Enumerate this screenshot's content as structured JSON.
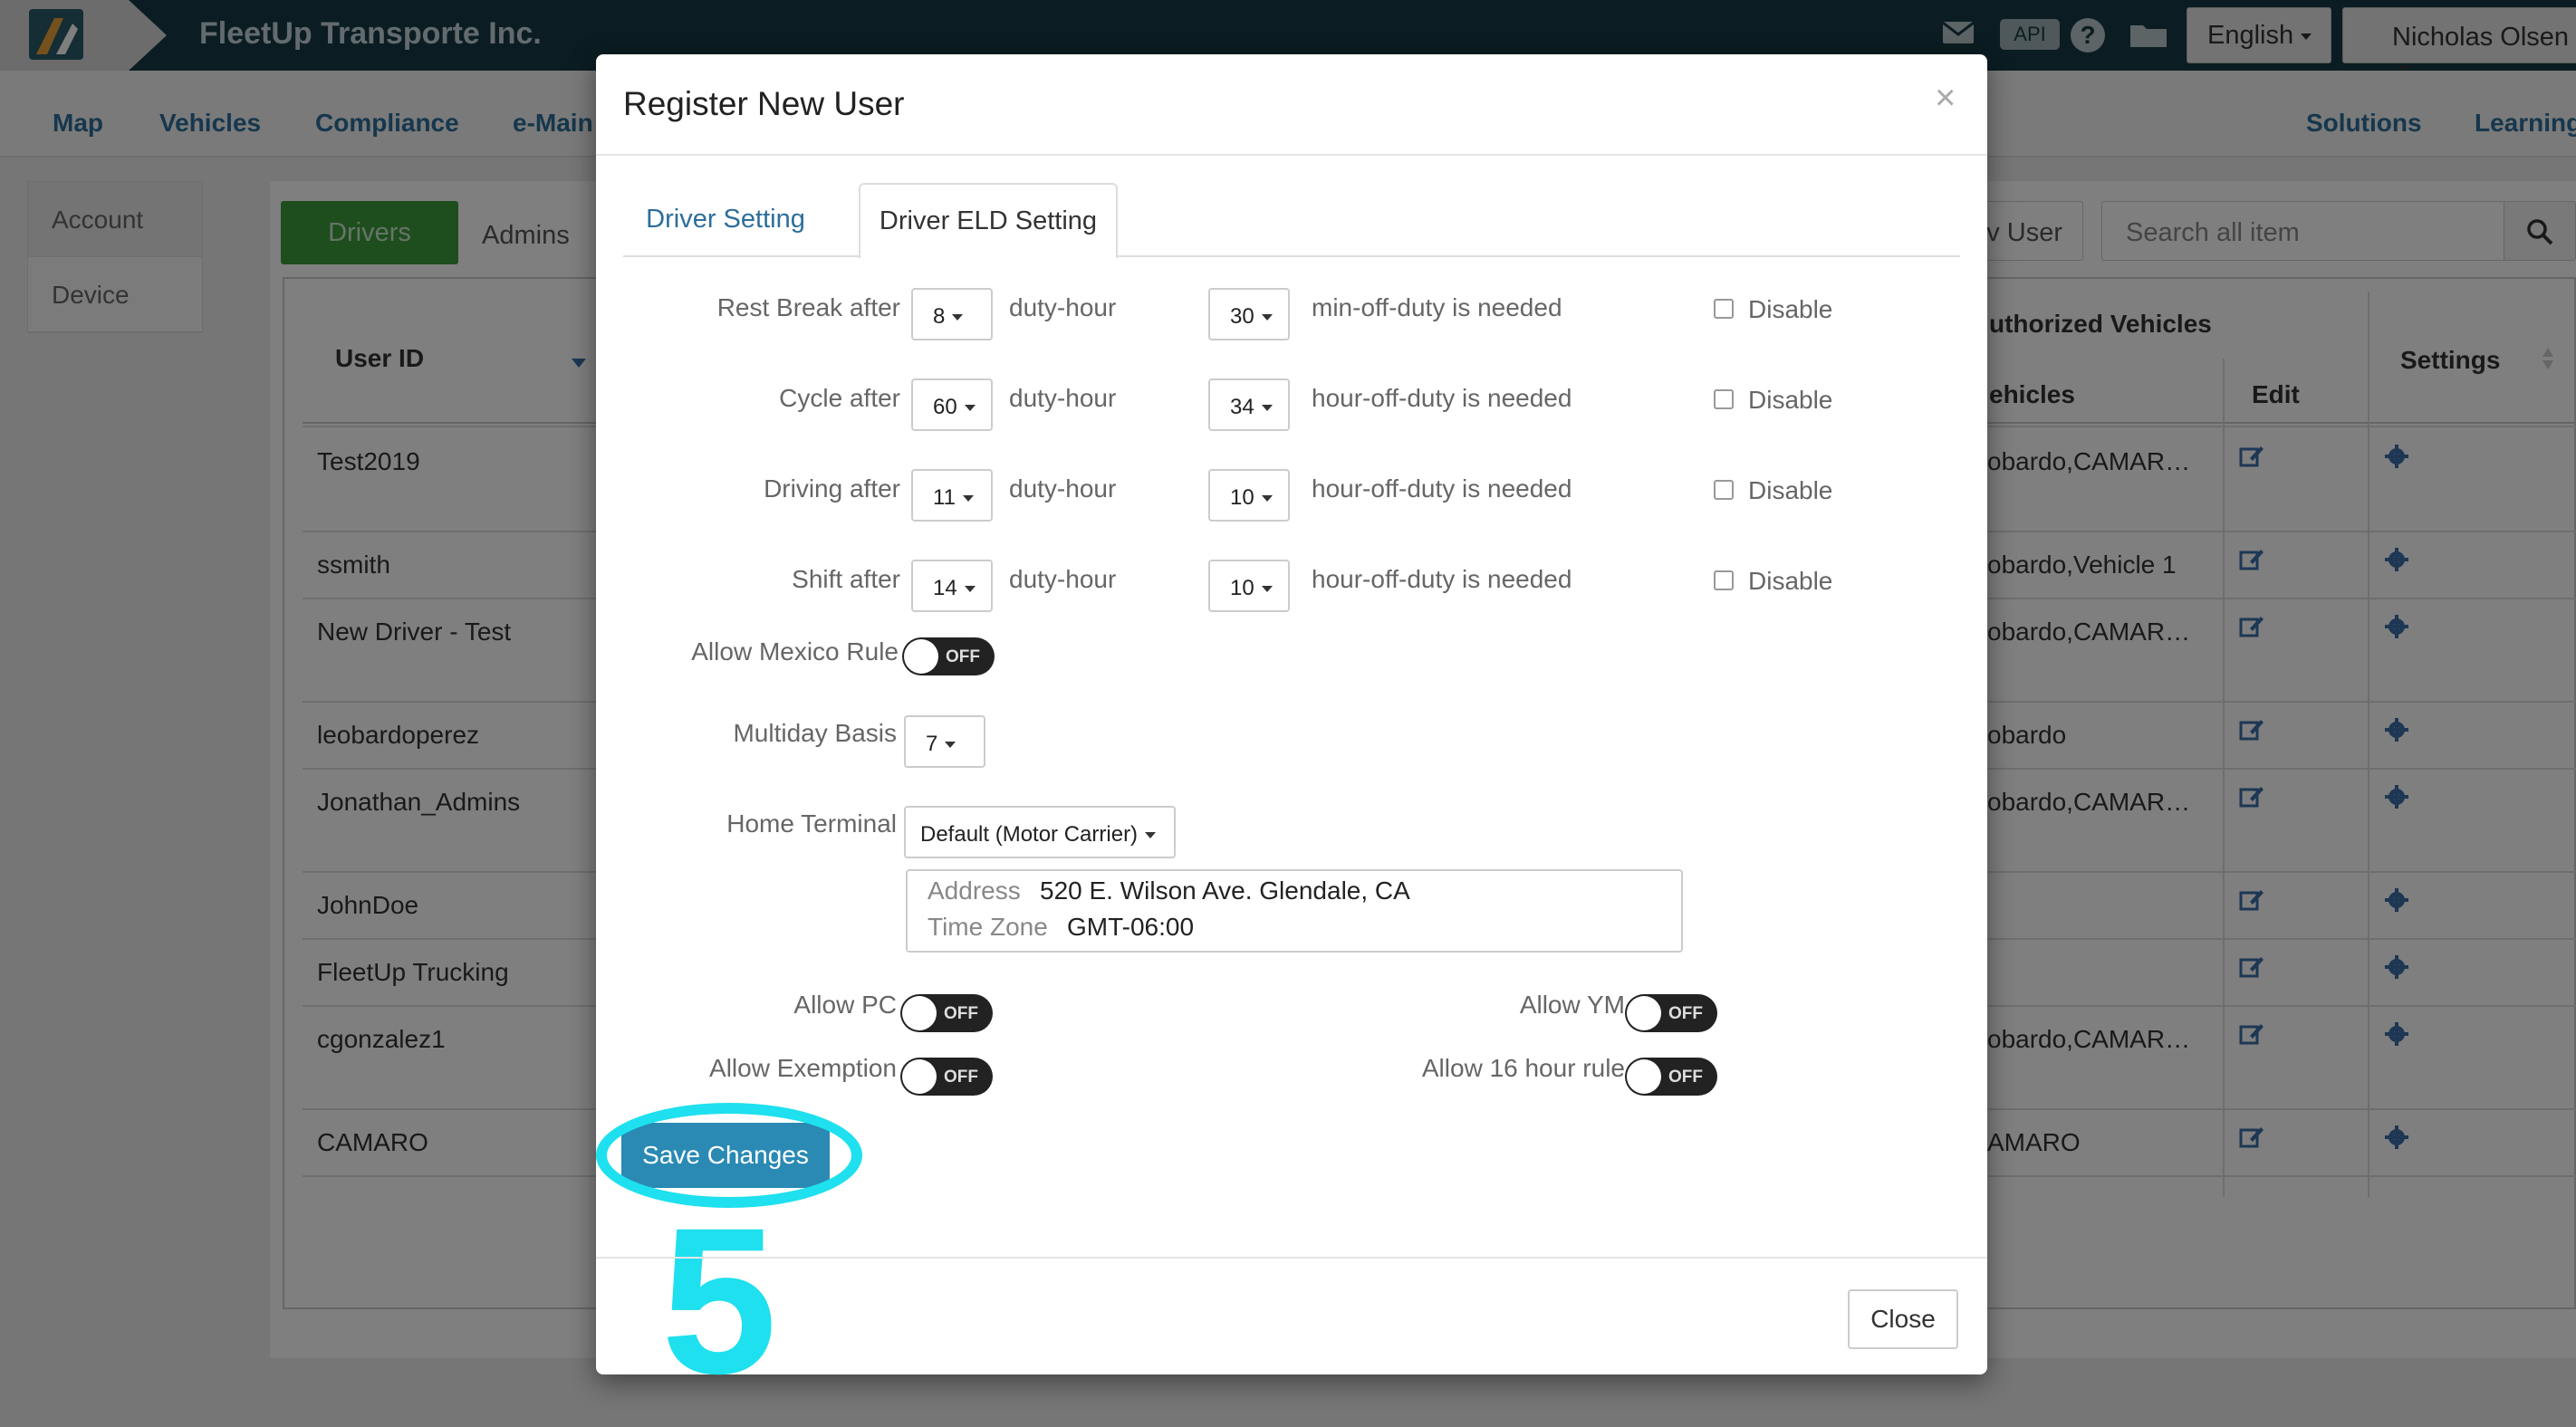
{
  "app": {
    "company": "FleetUp Transporte Inc.",
    "api_label": "API",
    "help_label": "?",
    "language": "English",
    "user": "Nicholas Olsen"
  },
  "nav": {
    "items": [
      "Map",
      "Vehicles",
      "Compliance",
      "e-Main"
    ],
    "right_items": [
      "Solutions",
      "Learning"
    ]
  },
  "side_menu": [
    "Account",
    "Device"
  ],
  "page": {
    "tab_drivers": "Drivers",
    "tab_admins": "Admins",
    "add_user_fragment": "v User",
    "search_placeholder": "Search all item"
  },
  "table": {
    "col_user_id": "User ID",
    "col_authorized_vehicles": "uthorized Vehicles",
    "col_vehicles": "ehicles",
    "col_edit": "Edit",
    "col_settings": "Settings",
    "rows": [
      {
        "user_id": "Test2019",
        "vehicles": "obardo,CAMAR…"
      },
      {
        "user_id": "ssmith",
        "vehicles": "obardo,Vehicle 1"
      },
      {
        "user_id": "New Driver - Test",
        "vehicles": "obardo,CAMAR…"
      },
      {
        "user_id": "leobardoperez",
        "vehicles": "obardo"
      },
      {
        "user_id": "Jonathan_Admins",
        "vehicles": "obardo,CAMAR…"
      },
      {
        "user_id": "JohnDoe",
        "vehicles": ""
      },
      {
        "user_id": "FleetUp Trucking",
        "vehicles": ""
      },
      {
        "user_id": "cgonzalez1",
        "vehicles": "obardo,CAMAR…"
      },
      {
        "user_id": "CAMARO",
        "vehicles": "AMARO"
      }
    ]
  },
  "modal": {
    "title": "Register New User",
    "close_x": "×",
    "tab_driver_setting": "Driver Setting",
    "tab_driver_eld_setting": "Driver ELD Setting",
    "rules": [
      {
        "label": "Rest Break after",
        "hours": "8",
        "unit": "duty-hour",
        "off_value": "30",
        "off_text": "min-off-duty is needed",
        "disable": "Disable"
      },
      {
        "label": "Cycle after",
        "hours": "60",
        "unit": "duty-hour",
        "off_value": "34",
        "off_text": "hour-off-duty is needed",
        "disable": "Disable"
      },
      {
        "label": "Driving after",
        "hours": "11",
        "unit": "duty-hour",
        "off_value": "10",
        "off_text": "hour-off-duty is needed",
        "disable": "Disable"
      },
      {
        "label": "Shift after",
        "hours": "14",
        "unit": "duty-hour",
        "off_value": "10",
        "off_text": "hour-off-duty is needed",
        "disable": "Disable"
      }
    ],
    "mexico_rule_label": "Allow Mexico Rule",
    "toggle_off": "OFF",
    "multiday_label": "Multiday Basis",
    "multiday_value": "7",
    "home_terminal_label": "Home Terminal",
    "home_terminal_value": "Default (Motor Carrier)",
    "address_key": "Address",
    "address_value": "520 E. Wilson Ave. Glendale, CA",
    "timezone_key": "Time Zone",
    "timezone_value": "GMT-06:00",
    "allow_pc": "Allow PC",
    "allow_ym": "Allow YM",
    "allow_exemption": "Allow Exemption",
    "allow_16_hour": "Allow 16 hour rule",
    "save_label": "Save Changes",
    "close_label": "Close"
  },
  "annotation": {
    "step_number": "5",
    "color": "#1ee0ef"
  }
}
